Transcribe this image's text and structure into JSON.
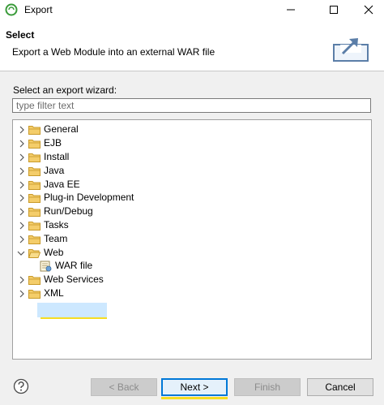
{
  "window": {
    "title": "Export"
  },
  "header": {
    "title": "Select",
    "description": "Export a Web Module into an external WAR file"
  },
  "wizard": {
    "label": "Select an export wizard:",
    "filter_placeholder": "type filter text",
    "filter_value": ""
  },
  "tree": {
    "items": [
      {
        "label": "General",
        "expanded": false
      },
      {
        "label": "EJB",
        "expanded": false
      },
      {
        "label": "Install",
        "expanded": false
      },
      {
        "label": "Java",
        "expanded": false
      },
      {
        "label": "Java EE",
        "expanded": false
      },
      {
        "label": "Plug-in Development",
        "expanded": false
      },
      {
        "label": "Run/Debug",
        "expanded": false
      },
      {
        "label": "Tasks",
        "expanded": false
      },
      {
        "label": "Team",
        "expanded": false
      },
      {
        "label": "Web",
        "expanded": true
      },
      {
        "label": "WAR file",
        "selected": true,
        "child": true
      },
      {
        "label": "Web Services",
        "expanded": false
      },
      {
        "label": "XML",
        "expanded": false
      }
    ]
  },
  "buttons": {
    "back": "< Back",
    "next": "Next >",
    "finish": "Finish",
    "cancel": "Cancel"
  },
  "colors": {
    "folder": "#e8b84a",
    "selection": "#cde8ff",
    "highlight": "#f6dd22",
    "default_button_border": "#0078d7"
  },
  "icons": {
    "app": "eclipse-icon",
    "header": "export-icon",
    "help": "help-icon",
    "folder": "folder-icon",
    "war": "war-file-icon"
  }
}
